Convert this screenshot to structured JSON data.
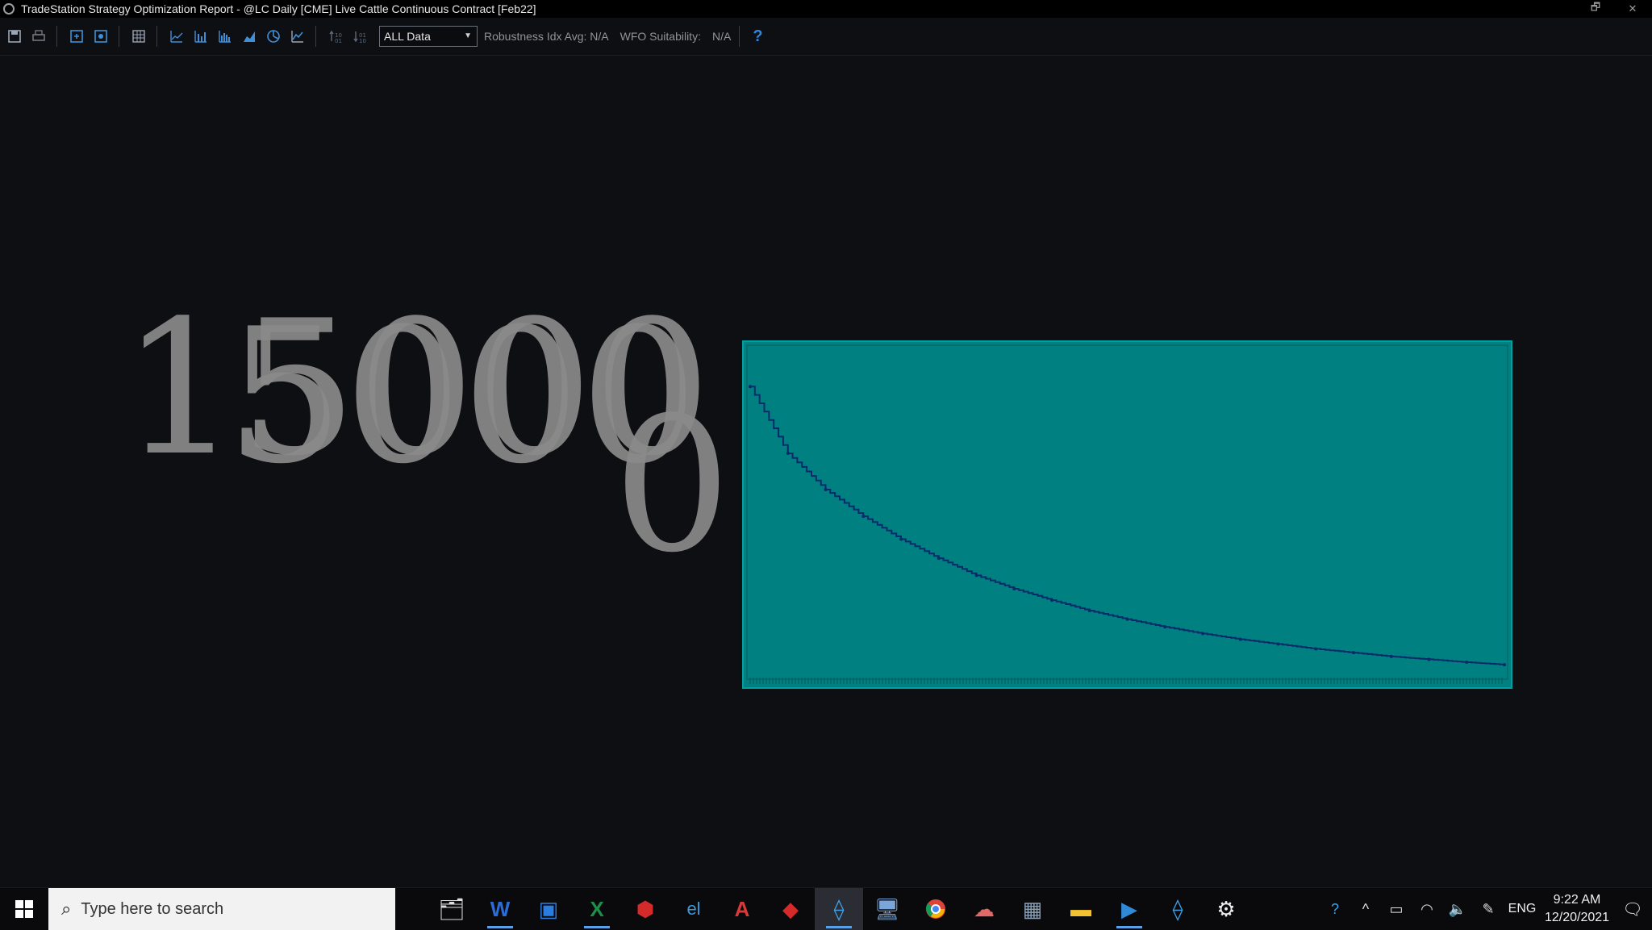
{
  "window": {
    "title": "TradeStation Strategy Optimization Report - @LC Daily [CME] Live Cattle Continuous Contract [Feb22]",
    "restore_label": "🗗",
    "close_label": "✕"
  },
  "toolbar": {
    "icons": [
      "save-icon",
      "print-icon",
      "fit-icon",
      "settings-icon",
      "grid-icon",
      "line-chart-icon",
      "bar-chart-icon",
      "histogram-icon",
      "area-chart-icon",
      "pie-chart-icon",
      "mountain-chart-icon",
      "sort-asc-icon",
      "sort-desc-icon"
    ],
    "dataset_select": "ALL Data",
    "robustness_label": "Robustness Idx Avg: N/A",
    "wfo_label": "WFO Suitability:",
    "wfo_value": "N/A",
    "help_label": "?"
  },
  "chart_data": {
    "type": "line",
    "title": "",
    "xlabel": "",
    "ylabel": "",
    "overlapping_axis_labels": [
      "15000",
      "5000",
      "0"
    ],
    "plot_background": "#008080",
    "line_color": "#0a2a6a",
    "description_curve": "decaying",
    "x": [
      0,
      5,
      10,
      15,
      20,
      25,
      30,
      35,
      40,
      45,
      50,
      55,
      60,
      65,
      70,
      75,
      80,
      85,
      90,
      95,
      100
    ],
    "values": [
      15000,
      11500,
      9600,
      8200,
      7000,
      6000,
      5100,
      4400,
      3800,
      3250,
      2800,
      2400,
      2050,
      1750,
      1500,
      1250,
      1050,
      850,
      700,
      550,
      420
    ],
    "ylim": [
      0,
      17000
    ]
  },
  "taskbar": {
    "search_placeholder": "Type here to search",
    "apps": [
      "file-explorer-icon",
      "word-icon",
      "tradestation-t-icon",
      "excel-icon",
      "acrobat-icon",
      "easylanguage-icon",
      "autocad-icon",
      "adobe-reader-icon",
      "tradestation-icon",
      "remote-desktop-icon",
      "chrome-icon",
      "paint-icon",
      "calculator-icon",
      "folder-icon",
      "media-icon",
      "tradestation-dev-icon",
      "settings-icon"
    ],
    "language": "ENG",
    "time": "9:22 AM",
    "date": "12/20/2021"
  },
  "colors": {
    "teal": "#008080",
    "accent_blue": "#2e86de"
  }
}
